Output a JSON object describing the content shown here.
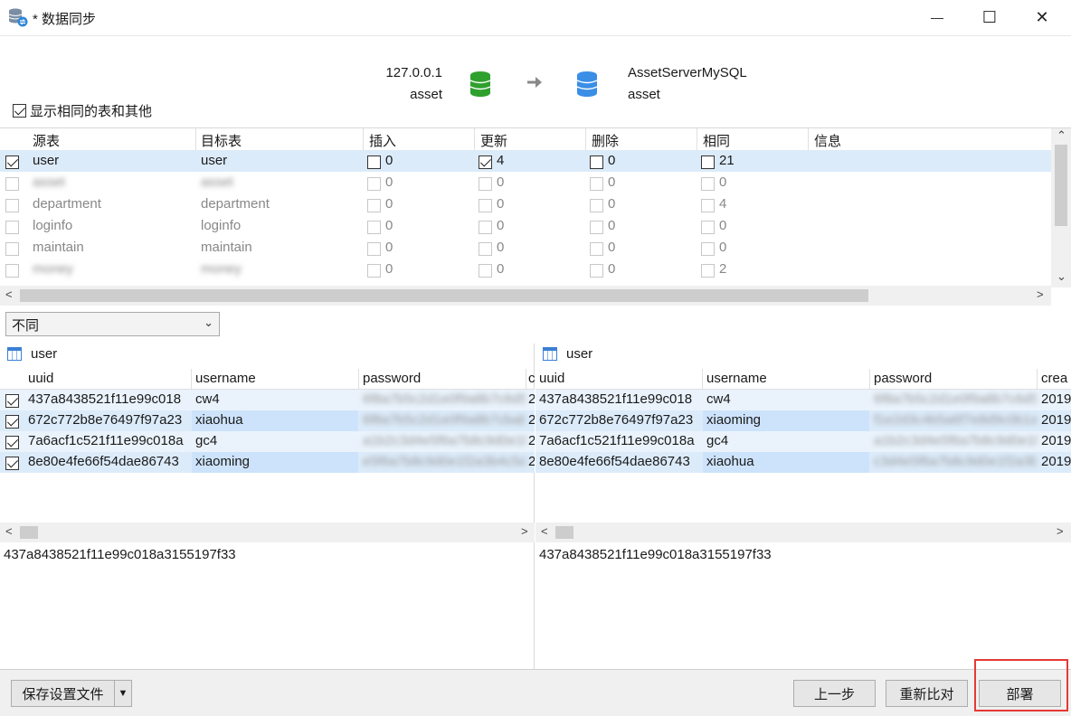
{
  "window": {
    "title": "* 数据同步",
    "minimize": "—",
    "maximize": "☐",
    "close": "✕"
  },
  "source": {
    "host": "127.0.0.1",
    "db": "asset"
  },
  "target": {
    "host": "AssetServerMySQL",
    "db": "asset"
  },
  "show_same_label": "显示相同的表和其他",
  "table_list": {
    "headers": [
      "源表",
      "目标表",
      "插入",
      "更新",
      "删除",
      "相同",
      "信息"
    ],
    "rows": [
      {
        "checked": true,
        "src": "user",
        "dst": "user",
        "insert": "0",
        "update": "4",
        "update_checked": true,
        "delete": "0",
        "same": "21"
      },
      {
        "checked": false,
        "src": "asset",
        "dst": "asset",
        "insert": "0",
        "update": "0",
        "delete": "0",
        "same": "0"
      },
      {
        "checked": false,
        "src": "department",
        "dst": "department",
        "insert": "0",
        "update": "0",
        "delete": "0",
        "same": "4"
      },
      {
        "checked": false,
        "src": "loginfo",
        "dst": "loginfo",
        "insert": "0",
        "update": "0",
        "delete": "0",
        "same": "0"
      },
      {
        "checked": false,
        "src": "maintain",
        "dst": "maintain",
        "insert": "0",
        "update": "0",
        "delete": "0",
        "same": "0"
      },
      {
        "checked": false,
        "src": "money",
        "dst": "money",
        "insert": "0",
        "update": "0",
        "delete": "0",
        "same": "2"
      }
    ]
  },
  "filter": {
    "selected": "不同",
    "chevron": "⌄"
  },
  "left_pane": {
    "table": "user",
    "headers": [
      "uuid",
      "username",
      "password",
      "c"
    ],
    "rows": [
      {
        "checked": true,
        "uuid": "437a8438521f11e99c018",
        "username": "cw4",
        "password": "6f8a7b5c2d1e0f9a8b7c6d5e4f",
        "extra": "2"
      },
      {
        "checked": true,
        "uuid": "672c772b8e76497f97a23",
        "username": "xiaohua",
        "password": "6f8a7b5c2d1e0f9a8b7cbab",
        "extra": "2"
      },
      {
        "checked": true,
        "uuid": "7a6acf1c521f11e99c018a",
        "username": "gc4",
        "password": "a1b2c3d4e5f6a7b8c9d0e1f2",
        "extra": "2"
      },
      {
        "checked": true,
        "uuid": "8e80e4fe66f54dae86743",
        "username": "xiaoming",
        "password": "e5f6a7b8c9d0e1f2a3b4c5d6",
        "extra": "2"
      }
    ],
    "value": "437a8438521f11e99c018a3155197f33"
  },
  "right_pane": {
    "table": "user",
    "headers": [
      "uuid",
      "username",
      "password",
      "crea"
    ],
    "rows": [
      {
        "uuid": "437a8438521f11e99c018",
        "username": "cw4",
        "password": "6f8a7b5c2d1e0f9a8b7c6d5e4f",
        "created": "2019"
      },
      {
        "uuid": "672c772b8e76497f97a23",
        "username": "xiaoming",
        "password": "f1e2d3c4b5a6f7e8d9c0b1a2",
        "created": "2019"
      },
      {
        "uuid": "7a6acf1c521f11e99c018a",
        "username": "gc4",
        "password": "a1b2c3d4e5f6a7b8c9d0e1f2",
        "created": "2019"
      },
      {
        "uuid": "8e80e4fe66f54dae86743",
        "username": "xiaohua",
        "password": "c3d4e5f6a7b8c9d0e1f2a3b4",
        "created": "2019"
      }
    ],
    "value": "437a8438521f11e99c018a3155197f33"
  },
  "buttons": {
    "save_settings": "保存设置文件",
    "dropdown_arrow": "▼",
    "prev": "上一步",
    "recompare": "重新比对",
    "deploy": "部署"
  },
  "colors": {
    "source_db": "#2ea02e",
    "target_db": "#3a8ee6",
    "selection": "#dcebfa",
    "highlight": "#e53935"
  }
}
